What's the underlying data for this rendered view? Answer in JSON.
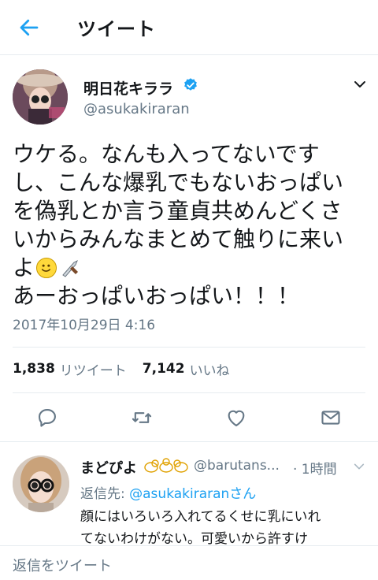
{
  "header": {
    "title": "ツイート",
    "back_icon": "arrow-left-icon"
  },
  "tweet": {
    "author_name": "明日花キララ",
    "author_handle": "@asukakiraran",
    "verified": true,
    "body_lines": [
      "ウケる。なんも入ってないです",
      "し、こんな爆乳でもないおっぱい",
      "を偽乳とか言う童貞共めんどくさ",
      "いからみんなまとめて触りに来い",
      "よ",
      "あーおっぱいおっぱい！！！"
    ],
    "emojis": [
      "smiling-face-icon",
      "knife-icon"
    ],
    "timestamp": "2017年10月29日 4:16",
    "retweet_count": "1,838",
    "retweet_label": "リツイート",
    "like_count": "7,142",
    "like_label": "いいね"
  },
  "actions": [
    "reply-icon",
    "retweet-icon",
    "like-icon",
    "message-icon"
  ],
  "reply": {
    "author_name": "まどぴよ",
    "author_handle": "@barutans...",
    "time": "· 1時間",
    "reply_to_prefix": "返信先: ",
    "reply_to_handle": "@asukakiraranさん",
    "text_lines": [
      "顔にはいろいろ入れてるくせに乳にいれ",
      "てないわけがない。可愛いから許すけ"
    ]
  },
  "compose": {
    "placeholder": "返信をツイート"
  },
  "colors": {
    "accent": "#1da1f2",
    "muted": "#657786",
    "text": "#14171a",
    "border": "#e6ecf0"
  }
}
